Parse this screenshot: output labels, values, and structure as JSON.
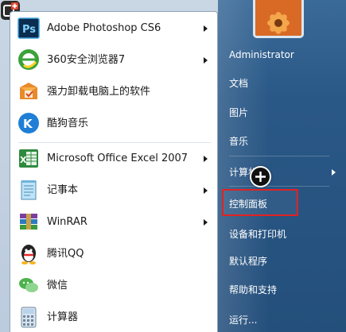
{
  "programs": [
    {
      "label": "Adobe Photoshop CS6",
      "icon": "photoshop-icon",
      "has_submenu": true
    },
    {
      "label": "360安全浏览器7",
      "icon": "360-browser-icon",
      "has_submenu": true
    },
    {
      "label": "强力卸载电脑上的软件",
      "icon": "uninstaller-icon",
      "has_submenu": false
    },
    {
      "label": "酷狗音乐",
      "icon": "kugou-icon",
      "has_submenu": false
    },
    {
      "label": "Microsoft Office Excel 2007",
      "icon": "excel-icon",
      "has_submenu": true
    },
    {
      "label": "记事本",
      "icon": "notepad-icon",
      "has_submenu": true
    },
    {
      "label": "WinRAR",
      "icon": "winrar-icon",
      "has_submenu": true
    },
    {
      "label": "腾讯QQ",
      "icon": "qq-icon",
      "has_submenu": false
    },
    {
      "label": "微信",
      "icon": "wechat-icon",
      "has_submenu": false
    },
    {
      "label": "计算器",
      "icon": "calculator-icon",
      "has_submenu": false
    }
  ],
  "places": [
    {
      "label": "Administrator"
    },
    {
      "label": "文档"
    },
    {
      "label": "图片"
    },
    {
      "label": "音乐"
    },
    {
      "label": "计算机"
    },
    {
      "label": "控制面板",
      "highlighted": true
    },
    {
      "label": "设备和打印机"
    },
    {
      "label": "默认程序"
    },
    {
      "label": "帮助和支持"
    },
    {
      "label": "运行..."
    }
  ],
  "colors": {
    "right_panel": "#2a5886",
    "highlight_border": "#e22222",
    "menu_text": "#1a1a1a",
    "place_text": "#ffffff"
  }
}
